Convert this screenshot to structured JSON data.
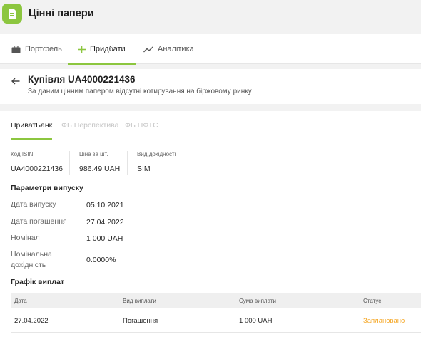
{
  "app": {
    "title": "Цінні папери",
    "accent": "#8cc63f"
  },
  "nav_tabs": [
    {
      "label": "Портфель",
      "icon": "briefcase-icon"
    },
    {
      "label": "Придбати",
      "icon": "plus-icon",
      "active": true
    },
    {
      "label": "Аналітика",
      "icon": "trend-chart-icon"
    }
  ],
  "purchase": {
    "title": "Купівля UA4000221436",
    "subtitle": "За даним цінним папером відсутні котирування на біржовому ринку"
  },
  "banks": [
    {
      "label": "ПриватБанк",
      "active": true
    },
    {
      "label": "ФБ Перспектива"
    },
    {
      "label": "ФБ ПФТС"
    }
  ],
  "info": [
    {
      "label": "Код ISIN",
      "value": "UA4000221436"
    },
    {
      "label": "Ціна за шт.",
      "value": "986.49 UAH"
    },
    {
      "label": "Вид дохідності",
      "value": "SIM"
    }
  ],
  "params": {
    "section_title": "Параметри випуску",
    "rows": [
      {
        "label": "Дата випуску",
        "value": "05.10.2021"
      },
      {
        "label": "Дата погашення",
        "value": "27.04.2022"
      },
      {
        "label": "Номінал",
        "value": "1 000 UAH"
      },
      {
        "label": "Номінальна дохідність",
        "value": "0.0000%"
      }
    ]
  },
  "schedule": {
    "section_title": "Графік виплат",
    "columns": [
      "Дата",
      "Вид виплати",
      "Сума виплати",
      "Статус"
    ],
    "rows": [
      {
        "date": "27.04.2022",
        "type": "Погашення",
        "amount": "1 000 UAH",
        "status": "Заплановано",
        "status_color": "#f5a623"
      }
    ]
  }
}
